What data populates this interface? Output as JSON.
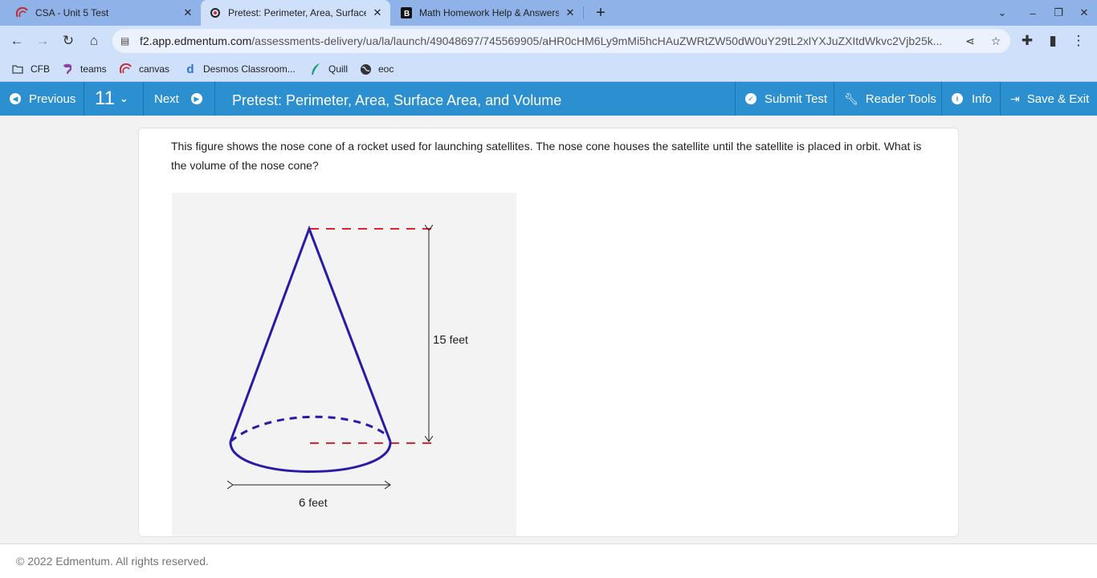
{
  "browser": {
    "tabs": [
      {
        "title": "CSA - Unit 5 Test",
        "icon": "cfb-icon"
      },
      {
        "title": "Pretest: Perimeter, Area, Surface",
        "icon": "edmentum-icon"
      },
      {
        "title": "Math Homework Help & Answers",
        "icon": "brainly-icon"
      }
    ],
    "url_host": "f2.app.edmentum.com",
    "url_path": "/assessments-delivery/ua/la/launch/49048697/745569905/aHR0cHM6Ly9mMi5hcHAuZWRtZW50dW0uY29tL2xlYXJuZXItdWkvc2Vjb25k...",
    "bookmarks": [
      {
        "label": "CFB",
        "icon": "folder-icon"
      },
      {
        "label": "teams",
        "icon": "teams-icon"
      },
      {
        "label": "canvas",
        "icon": "cfb-icon"
      },
      {
        "label": "Desmos Classroom...",
        "icon": "desmos-icon"
      },
      {
        "label": "Quill",
        "icon": "quill-icon"
      },
      {
        "label": "eoc",
        "icon": "globe-icon"
      }
    ]
  },
  "appbar": {
    "previous": "Previous",
    "question_number": "11",
    "next": "Next",
    "title": "Pretest: Perimeter, Area, Surface Area, and Volume",
    "submit": "Submit Test",
    "reader_tools": "Reader Tools",
    "info": "Info",
    "save_exit": "Save & Exit"
  },
  "question": {
    "text": "This figure shows the nose cone of a rocket used for launching satellites. The nose cone houses the satellite until the satellite is placed in orbit. What is the volume of the nose cone?",
    "height_value": "15",
    "height_unit": "feet",
    "diameter_value": "6",
    "diameter_unit": "feet"
  },
  "colors": {
    "accent": "#2c8fd0",
    "cone": "#2a1aa8",
    "guide": "#e0242b"
  },
  "footer": "© 2022 Edmentum. All rights reserved."
}
